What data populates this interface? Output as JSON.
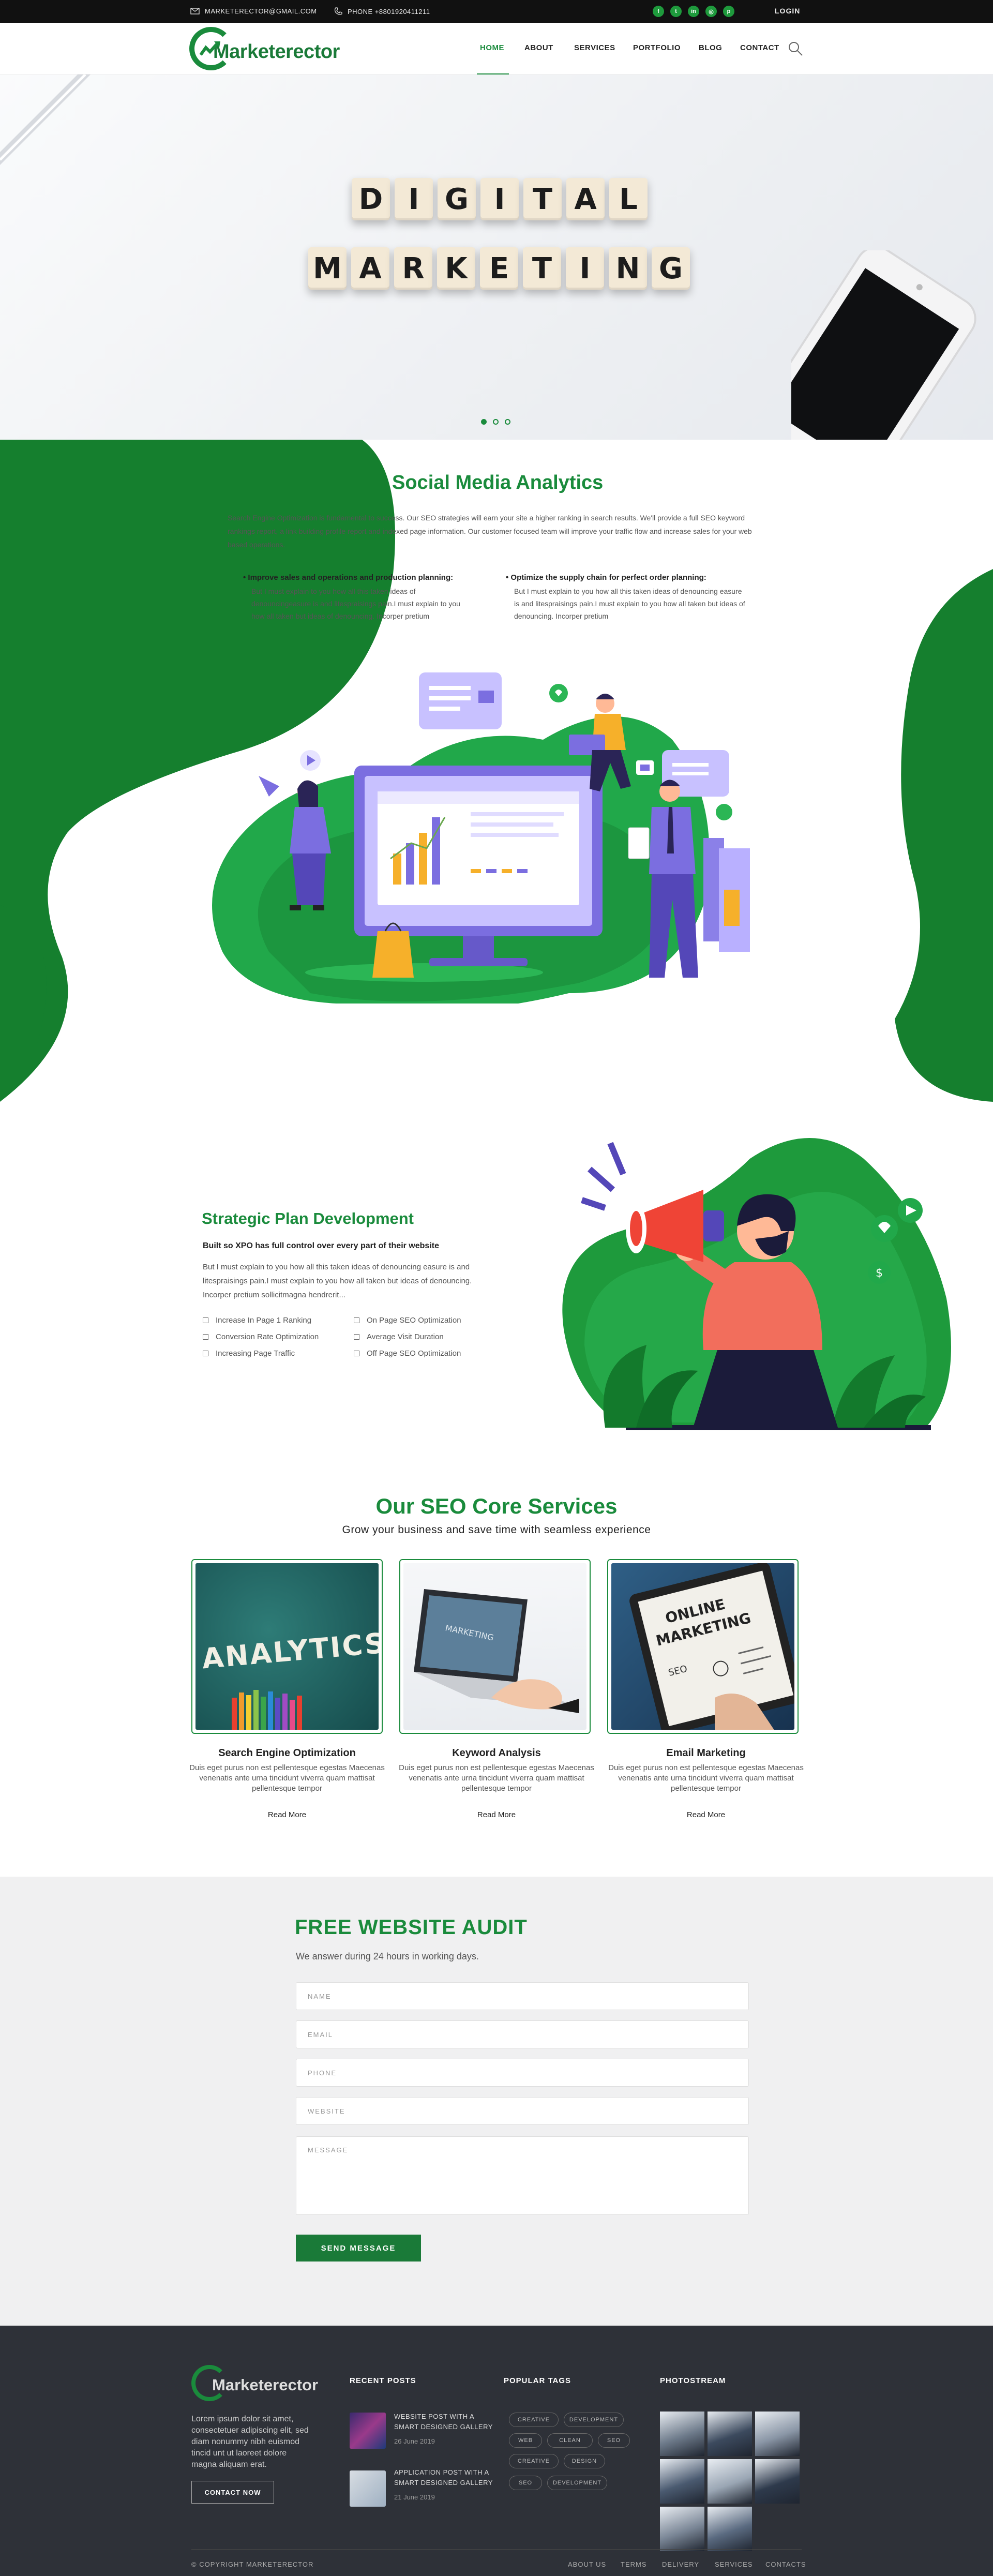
{
  "topbar": {
    "email": "MARKETERECTOR@GMAIL.COM",
    "phone": "PHONE +8801920411211",
    "login": "LOGIN",
    "socials": [
      "facebook-icon",
      "twitter-icon",
      "linkedin-icon",
      "instagram-icon",
      "pinterest-icon"
    ]
  },
  "nav": {
    "logo": "Marketerector",
    "items": [
      "HOME",
      "ABOUT",
      "SERVICES",
      "PORTFOLIO",
      "BLOG",
      "CONTACT"
    ],
    "active": "HOME"
  },
  "hero": {
    "row1": [
      "D",
      "I",
      "G",
      "I",
      "T",
      "A",
      "L"
    ],
    "row2": [
      "M",
      "A",
      "R",
      "K",
      "E",
      "T",
      "I",
      "N",
      "G"
    ],
    "slides": 3,
    "active_slide": 1
  },
  "analytics": {
    "title": "Social Media Analytics",
    "intro": "Search Engine Optimization is fundamental to success. Our SEO strategies will earn your site a higher ranking in search results. We'll provide a full SEO keyword rankings report, a link building profile report and indexed page information. Our customer focused team will improve your traffic flow and increase sales for your web based operations.",
    "points": [
      {
        "title": "Improve sales and operations and production planning:",
        "text": "But I must explain to you how all this taken ideas of denouncingeasure is and litespraisings pain.I must explain to you how all taken but ideas of denouncing. Incorper pretium"
      },
      {
        "title": "Optimize the supply chain for perfect order planning:",
        "text": "But I must explain to you how all this taken ideas of denouncing easure is and litespraisings pain.I must explain to you how all taken but ideas of denouncing. Incorper pretium"
      }
    ]
  },
  "strategic": {
    "title": "Strategic Plan Development",
    "subtitle": "Built so XPO has full control over every part of their website",
    "text": "But I must explain to you how all this taken ideas of denouncing easure is and litespraisings pain.I must explain to you how all taken but ideas of denouncing. Incorper pretium sollicitmagna hendrerit...",
    "col1": [
      "Increase In Page 1 Ranking",
      "Conversion Rate Optimization",
      "Increasing Page Traffic"
    ],
    "col2": [
      "On Page SEO Optimization",
      "Average Visit Duration",
      "Off Page SEO Optimization"
    ]
  },
  "services": {
    "title": "Our SEO Core Services",
    "subtitle": "Grow your business and save time with seamless experience",
    "items": [
      {
        "title": "Search Engine Optimization",
        "text": "Duis eget purus non est pellentesque egestas Maecenas venenatis ante urna tincidunt viverra quam mattisat pellentesque tempor",
        "link": "Read More",
        "img_text": "ANALYTICS"
      },
      {
        "title": "Keyword Analysis",
        "text": "Duis eget purus non est pellentesque egestas Maecenas venenatis ante urna tincidunt viverra quam mattisat pellentesque tempor",
        "link": "Read More",
        "img_text": "MARKETING"
      },
      {
        "title": "Email Marketing",
        "text": "Duis eget purus non est pellentesque egestas Maecenas venenatis ante urna tincidunt viverra quam mattisat pellentesque tempor",
        "link": "Read More",
        "img_text": "ONLINE MARKETING"
      }
    ]
  },
  "audit": {
    "title": "FREE WEBSITE AUDIT",
    "subtitle": "We answer during 24 hours in working days.",
    "fields": [
      "NAME",
      "EMAIL",
      "PHONE",
      "WEBSITE"
    ],
    "message": "MESSAGE",
    "button": "SEND MESSAGE"
  },
  "footer": {
    "logo": "Marketerector",
    "about": "Lorem ipsum dolor sit amet, consectetuer adipiscing elit, sed diam nonummy nibh euismod tincid  unt ut laoreet dolore magna aliquam erat.",
    "contact_btn": "CONTACT NOW",
    "recent_title": "RECENT POSTS",
    "posts": [
      {
        "title": "WEBSITE POST WITH A SMART DESIGNED GALLERY",
        "date": "26 June 2019"
      },
      {
        "title": "APPLICATION POST WITH A SMART DESIGNED GALLERY",
        "date": "21 June 2019"
      }
    ],
    "tags_title": "POPULAR TAGS",
    "tags": [
      "CREATIVE",
      "DEVELOPMENT",
      "WEB",
      "CLEAN",
      "SEO",
      "CREATIVE",
      "DESIGN",
      "SEO",
      "DEVELOPMENT"
    ],
    "photostream_title": "PHOTOSTREAM",
    "copyright": "© COPYRIGHT MARKETERECTOR",
    "links": [
      "ABOUT US",
      "TERMS",
      "DELIVERY",
      "SERVICES",
      "CONTACTS"
    ]
  }
}
